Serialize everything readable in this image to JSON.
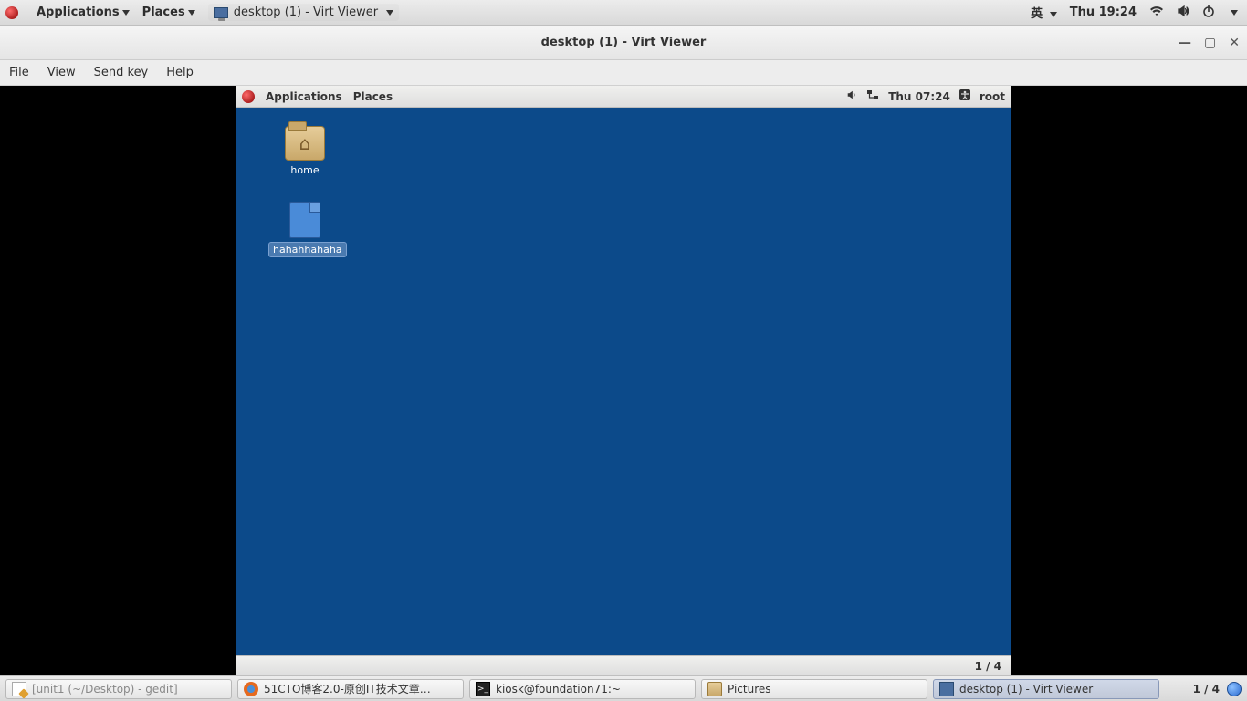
{
  "host_panel": {
    "apps_label": "Applications",
    "places_label": "Places",
    "running_app_label": "desktop (1) - Virt Viewer",
    "ime": "英",
    "clock": "Thu 19:24"
  },
  "virt_viewer": {
    "title": "desktop (1) - Virt Viewer",
    "menu": {
      "file": "File",
      "view": "View",
      "sendkey": "Send key",
      "help": "Help"
    }
  },
  "guest_panel": {
    "apps_label": "Applications",
    "places_label": "Places",
    "clock": "Thu 07:24",
    "user": "root"
  },
  "guest_desktop": {
    "icon_home": "home",
    "icon_file": "hahahhahaha",
    "workspace": "1 / 4"
  },
  "taskbar": {
    "items": [
      "[unit1 (~/Desktop) - gedit]",
      "51CTO博客2.0-原创IT技术文章…",
      "kiosk@foundation71:~",
      "Pictures",
      "desktop (1) - Virt Viewer"
    ],
    "workspace": "1 / 4"
  }
}
